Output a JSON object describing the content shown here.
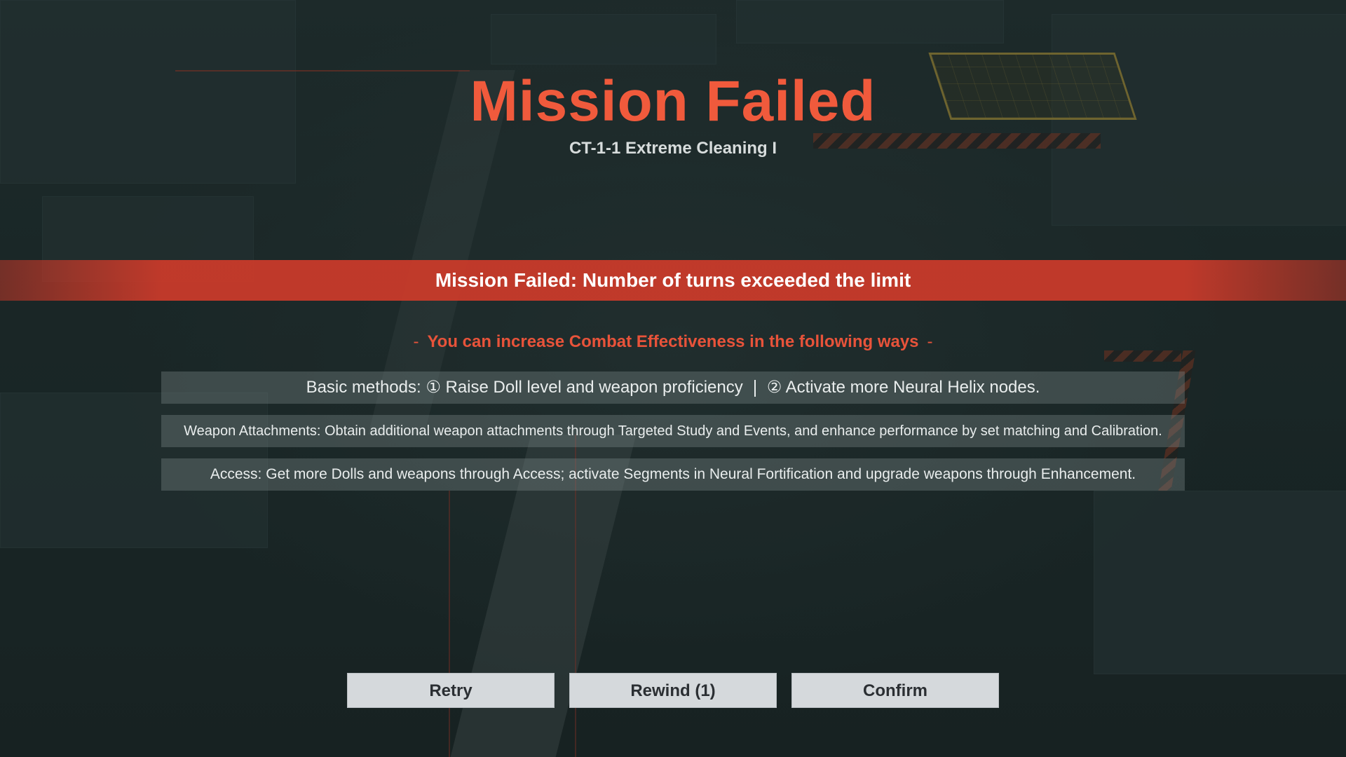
{
  "result": {
    "title": "Mission Failed",
    "stage": "CT-1-1 Extreme Cleaning I",
    "fail_reason": "Mission Failed: Number of turns exceeded the limit"
  },
  "tips": {
    "heading": "You can increase Combat Effectiveness in the following ways",
    "dash": "-",
    "basic_part1": "Basic methods: ① Raise Doll level and weapon proficiency",
    "basic_part2": "② Activate more Neural Helix nodes.",
    "weapon_attachments": "Weapon Attachments: Obtain additional weapon attachments through Targeted Study and Events, and enhance performance by set matching and Calibration.",
    "access": "Access: Get more Dolls and weapons through Access; activate Segments in Neural Fortification and upgrade weapons through Enhancement."
  },
  "buttons": {
    "retry": "Retry",
    "rewind": "Rewind (1)",
    "confirm": "Confirm"
  },
  "colors": {
    "title": "#f05a3c",
    "banner": "#c83a2a",
    "heading": "#e8533a",
    "button_bg": "#d5d9dc"
  }
}
